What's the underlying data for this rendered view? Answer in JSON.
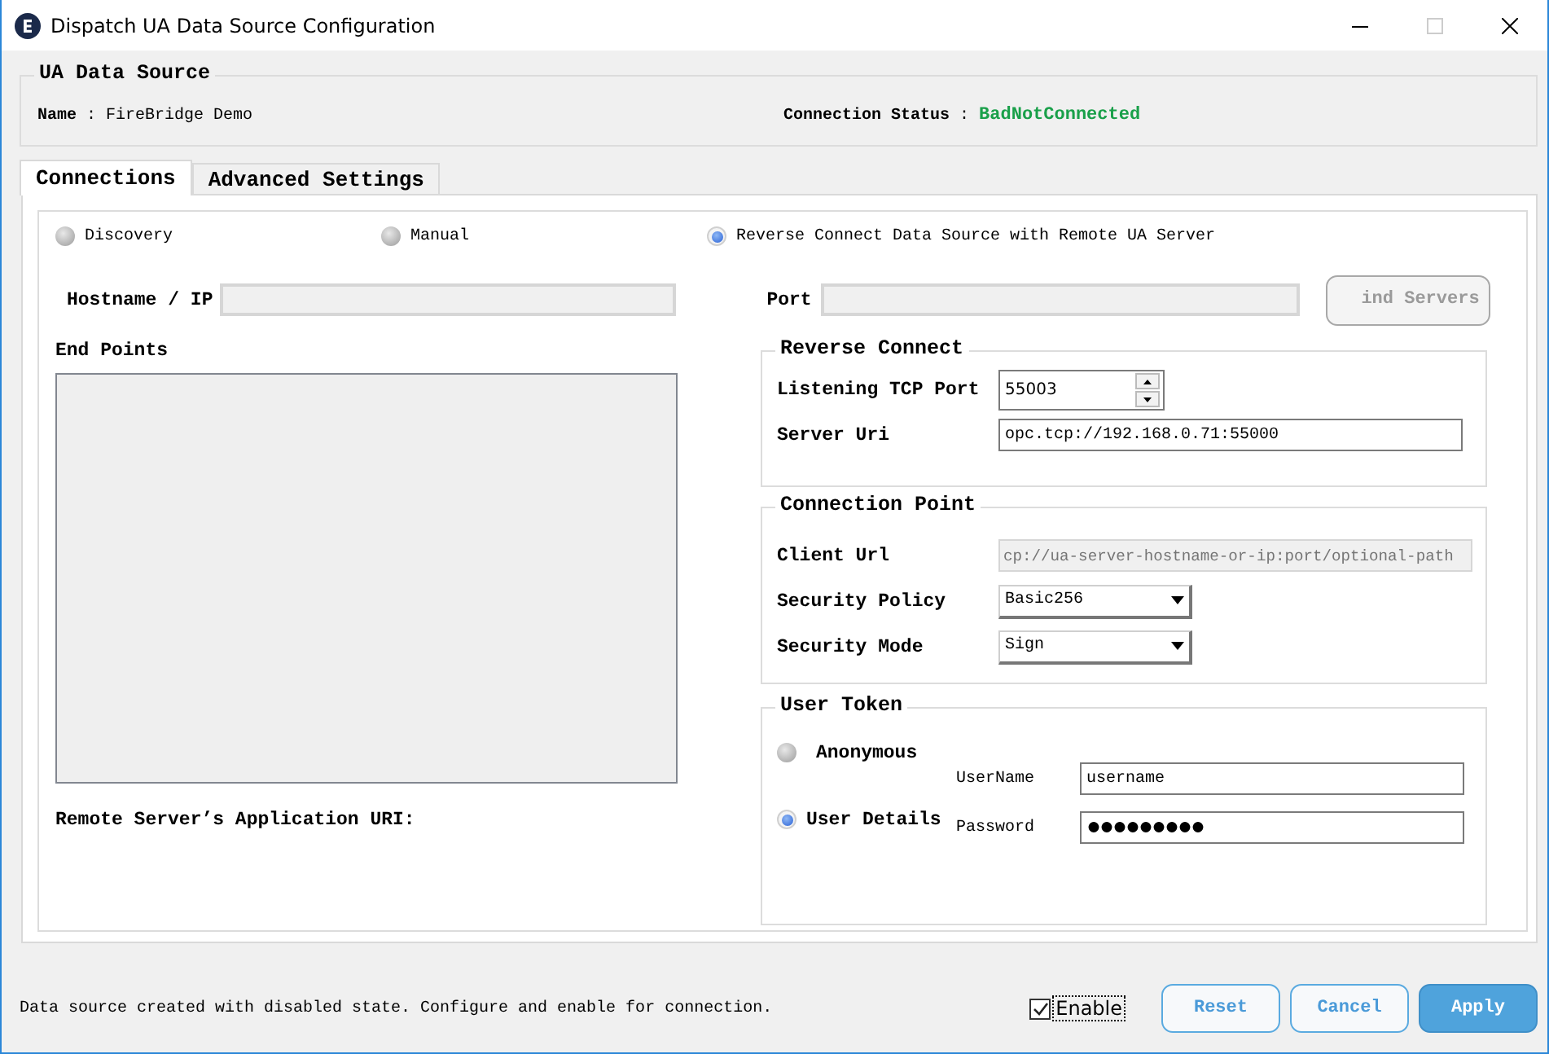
{
  "window": {
    "title": "Dispatch UA Data Source Configuration"
  },
  "data_source": {
    "title": "UA Data Source",
    "name": "**Name** : FireBridge Demo",
    "status_label": "**Connection Status** :",
    "status_value": "BadNotConnected"
  },
  "tabs": [
    {
      "label": "Connections",
      "selected": true
    },
    {
      "label": "Advanced Settings",
      "selected": false
    }
  ],
  "connection_modes": [
    {
      "label": "Discovery",
      "selected": false
    },
    {
      "label": "Manual",
      "selected": false
    },
    {
      "label": "Reverse Connect Data Source with Remote UA Server",
      "selected": true
    }
  ],
  "hostname": {
    "label": "Hostname / IP",
    "disabled": true
  },
  "port": {
    "label": "Port",
    "disabled": true
  },
  "find_servers_button": {
    "label": "ind Servers",
    "disabled": true
  },
  "end_points": {
    "label": "End Points"
  },
  "remote_uri_label": "Remote Server’s Application URI:",
  "reverse_connect": {
    "title": "Reverse Connect",
    "listening_port": {
      "label": "Listening TCP Port",
      "value": "55003"
    },
    "server_uri": {
      "label": "Server Uri",
      "value": "opc.tcp://192.168.0.71:55000"
    }
  },
  "connection_point": {
    "title": "Connection Point",
    "client_url": {
      "label": "Client Url",
      "placeholder": "cp://ua-server-hostname-or-ip:port/optional-path",
      "disabled": true
    },
    "security_policy": {
      "label": "Security Policy",
      "value": "Basic256"
    },
    "security_mode": {
      "label": "Security Mode",
      "value": "Sign"
    }
  },
  "user_token": {
    "title": "User Token",
    "options": [
      {
        "label": "Anonymous",
        "selected": false
      },
      {
        "label": "User Details",
        "selected": true
      }
    ],
    "username": {
      "label": "UserName",
      "value": "username"
    },
    "password": {
      "label": "Password",
      "value": "●●●●●●●●●"
    }
  },
  "footer": {
    "message": "Data source created with disabled state. Configure and enable for connection.",
    "enable": {
      "label": "Enable",
      "checked": true
    },
    "buttons": [
      {
        "label": "Reset",
        "kind": "secondary"
      },
      {
        "label": "Cancel",
        "kind": "secondary"
      },
      {
        "label": "Apply",
        "kind": "primary"
      }
    ]
  }
}
